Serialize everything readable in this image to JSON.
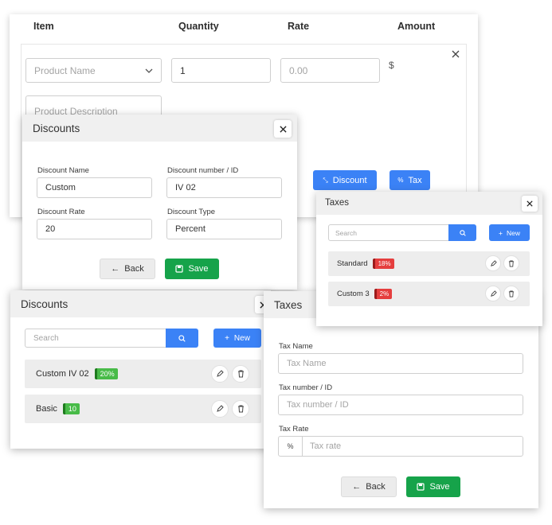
{
  "invoice": {
    "headers": {
      "item": "Item",
      "quantity": "Quantity",
      "rate": "Rate",
      "amount": "Amount"
    },
    "product_placeholder": "Product Name",
    "quantity_value": "1",
    "rate_placeholder": "0.00",
    "currency": "$",
    "description_placeholder": "Product Description",
    "discount_button": "Discount",
    "tax_button": "Tax"
  },
  "discount_form": {
    "title": "Discounts",
    "name_label": "Discount Name",
    "name_value": "Custom",
    "number_label": "Discount number / ID",
    "number_value": "IV 02",
    "rate_label": "Discount Rate",
    "rate_value": "20",
    "type_label": "Discount Type",
    "type_value": "Percent",
    "back_label": "Back",
    "save_label": "Save"
  },
  "taxes_list": {
    "title": "Taxes",
    "search_placeholder": "Search",
    "new_label": "New",
    "items": [
      {
        "name": "Standard",
        "badge": "18%"
      },
      {
        "name": "Custom 3",
        "badge": "2%"
      }
    ]
  },
  "discounts_list": {
    "title": "Discounts",
    "search_placeholder": "Search",
    "new_label": "New",
    "items": [
      {
        "name": "Custom IV 02",
        "badge": "20%"
      },
      {
        "name": "Basic",
        "badge": "10"
      }
    ]
  },
  "tax_form": {
    "title": "Taxes",
    "name_label": "Tax Name",
    "name_placeholder": "Tax Name",
    "number_label": "Tax number / ID",
    "number_placeholder": "Tax number / ID",
    "rate_label": "Tax Rate",
    "rate_symbol": "%",
    "rate_placeholder": "Tax rate",
    "back_label": "Back",
    "save_label": "Save"
  },
  "colors": {
    "accent_blue": "#3b82f6",
    "save_green": "#16a34a",
    "badge_red": "#e53e3e",
    "badge_green": "#48bb48"
  }
}
